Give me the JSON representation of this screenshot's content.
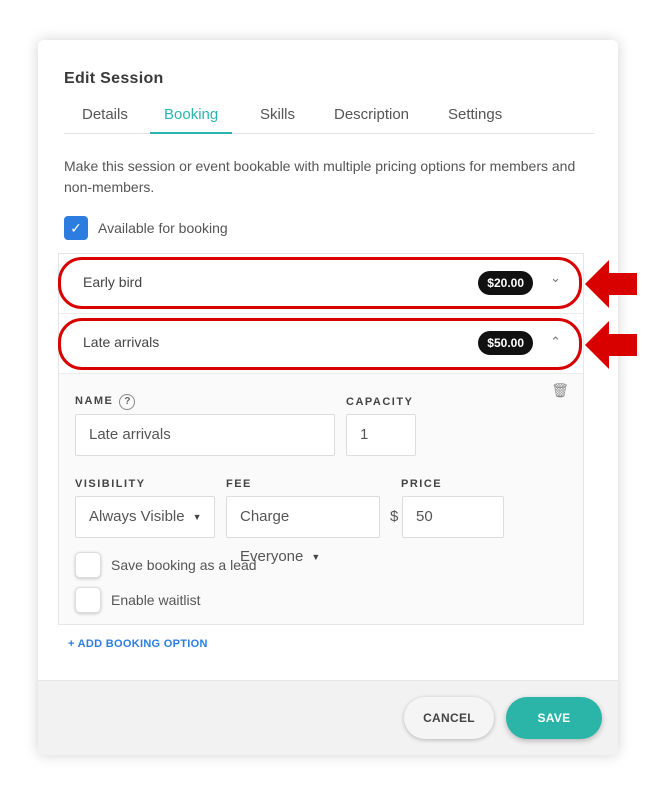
{
  "modal": {
    "title": "Edit Session",
    "tabs": [
      {
        "label": "Details",
        "active": false
      },
      {
        "label": "Booking",
        "active": true
      },
      {
        "label": "Skills",
        "active": false
      },
      {
        "label": "Description",
        "active": false
      },
      {
        "label": "Settings",
        "active": false
      }
    ],
    "description": "Make this session or event bookable with multiple pricing options for members and non-members.",
    "available_for_booking": {
      "label": "Available for booking",
      "checked": true
    }
  },
  "booking_options": [
    {
      "label": "Early bird",
      "price": "$20.00",
      "expanded": false,
      "chevron": "chevron-down-icon"
    },
    {
      "label": "Late arrivals",
      "price": "$50.00",
      "expanded": true,
      "chevron": "chevron-up-icon"
    }
  ],
  "expanded_option": {
    "name_label": "NAME",
    "help_icon": "?",
    "name_value": "Late arrivals",
    "capacity_label": "CAPACITY",
    "capacity_value": "1",
    "visibility_label": "VISIBILITY",
    "visibility_value": "Always Visible",
    "fee_label": "FEE",
    "fee_value": "Charge Everyone",
    "price_label": "PRICE",
    "currency": "$",
    "price_value": "50",
    "save_as_lead": {
      "label": "Save booking as a lead",
      "checked": false
    },
    "enable_waitlist": {
      "label": "Enable waitlist",
      "checked": false
    }
  },
  "add_option_label": "+ ADD BOOKING OPTION",
  "footer": {
    "cancel_label": "CANCEL",
    "save_label": "SAVE"
  },
  "colors": {
    "accent": "#2ab5b0",
    "checkbox": "#2d7de0",
    "annotation": "#d90000"
  }
}
